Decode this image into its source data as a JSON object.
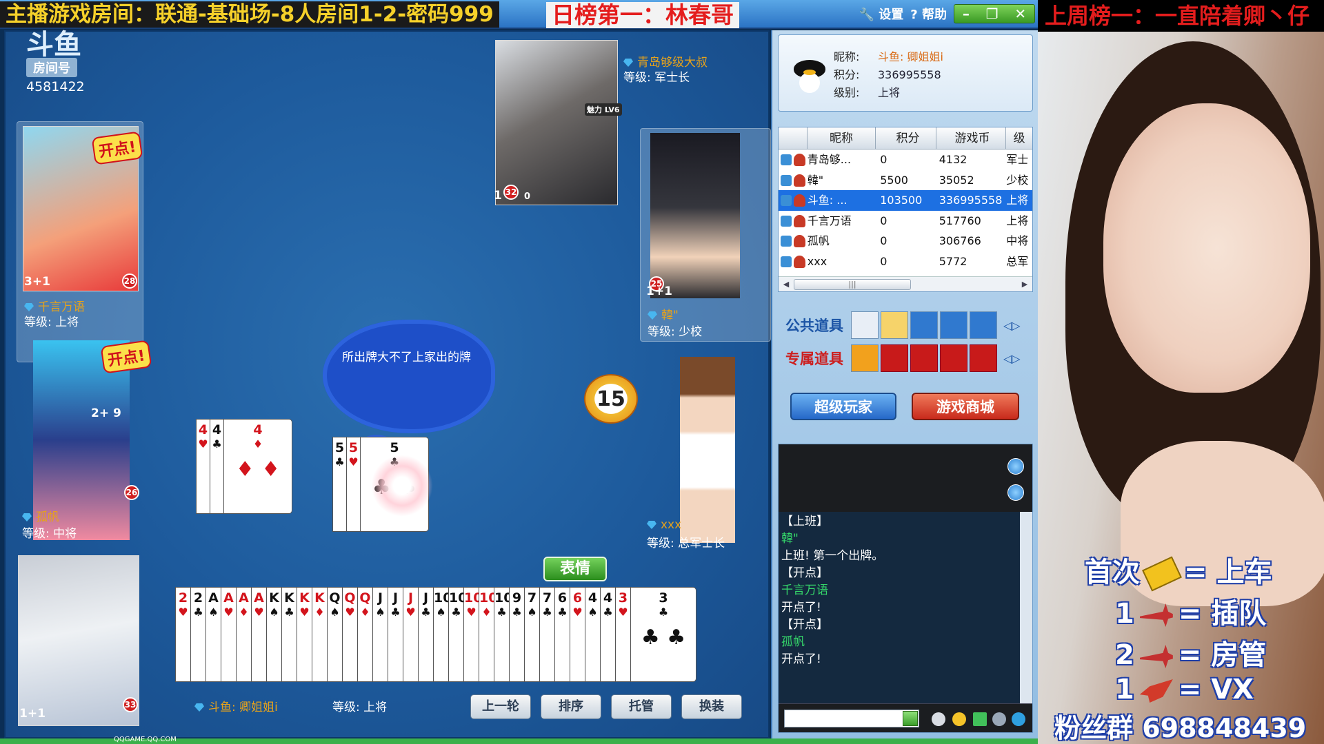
{
  "banners": {
    "room": "主播游戏房间：联通-基础场-8人房间1-2-密码999",
    "day": "日榜第一：林春哥",
    "week": "上周榜一：一直陪着卿丶仔"
  },
  "window": {
    "settings": "设置",
    "help": "帮助",
    "minimize": "–",
    "restore": "❐",
    "close": "✕"
  },
  "room": {
    "logo": "斗鱼",
    "label": "房间号",
    "number": "4581422"
  },
  "players": [
    {
      "name": "千言万语",
      "level": "等级: 上将",
      "badge": "28",
      "count": "3",
      "plus": "+1",
      "kaidian": "开点!"
    },
    {
      "name": "孤帆",
      "level": "等级: 中将",
      "badge": "26",
      "count": "2",
      "plus": "+ 9",
      "kaidian": "开点!"
    },
    {
      "name": "斗鱼: 卿姐姐i",
      "level": "等级: 上将",
      "badge": "33",
      "count": "1",
      "plus": "+1"
    },
    {
      "name": "青岛够级大叔",
      "level": "等级: 军士长",
      "badge": "32",
      "count": "1",
      "plus": "0",
      "tag": "魅力 LV6"
    },
    {
      "name": "韓\"",
      "level": "等级: 少校",
      "badge": "25",
      "count": "1",
      "plus": "+1"
    },
    {
      "name": "xxx",
      "level": "等级: 总军士长"
    }
  ],
  "table": {
    "cloud_msg": "所出牌大不了上家出的牌",
    "timer": "15",
    "emote_btn": "表情",
    "played_left": [
      {
        "rank": "4",
        "suit": "♥",
        "color": "red"
      },
      {
        "rank": "4",
        "suit": "♣",
        "color": "blk"
      },
      {
        "rank": "4",
        "suit": "♦",
        "color": "red"
      }
    ],
    "played_center": [
      {
        "rank": "5",
        "suit": "♣",
        "color": "blk"
      },
      {
        "rank": "5",
        "suit": "♥",
        "color": "red"
      },
      {
        "rank": "5",
        "suit": "♣",
        "color": "blk"
      }
    ],
    "hand": [
      {
        "rank": "2",
        "suit": "♥",
        "color": "red"
      },
      {
        "rank": "2",
        "suit": "♣",
        "color": "blk"
      },
      {
        "rank": "A",
        "suit": "♠",
        "color": "blk"
      },
      {
        "rank": "A",
        "suit": "♥",
        "color": "red"
      },
      {
        "rank": "A",
        "suit": "♦",
        "color": "red"
      },
      {
        "rank": "A",
        "suit": "♥",
        "color": "red"
      },
      {
        "rank": "K",
        "suit": "♠",
        "color": "blk"
      },
      {
        "rank": "K",
        "suit": "♣",
        "color": "blk"
      },
      {
        "rank": "K",
        "suit": "♥",
        "color": "red"
      },
      {
        "rank": "K",
        "suit": "♦",
        "color": "red"
      },
      {
        "rank": "Q",
        "suit": "♠",
        "color": "blk"
      },
      {
        "rank": "Q",
        "suit": "♥",
        "color": "red"
      },
      {
        "rank": "Q",
        "suit": "♦",
        "color": "red"
      },
      {
        "rank": "J",
        "suit": "♠",
        "color": "blk"
      },
      {
        "rank": "J",
        "suit": "♣",
        "color": "blk"
      },
      {
        "rank": "J",
        "suit": "♥",
        "color": "red"
      },
      {
        "rank": "J",
        "suit": "♣",
        "color": "blk"
      },
      {
        "rank": "10",
        "suit": "♠",
        "color": "blk"
      },
      {
        "rank": "10",
        "suit": "♣",
        "color": "blk"
      },
      {
        "rank": "10",
        "suit": "♥",
        "color": "red"
      },
      {
        "rank": "10",
        "suit": "♦",
        "color": "red"
      },
      {
        "rank": "10",
        "suit": "♣",
        "color": "blk"
      },
      {
        "rank": "9",
        "suit": "♣",
        "color": "blk"
      },
      {
        "rank": "7",
        "suit": "♠",
        "color": "blk"
      },
      {
        "rank": "7",
        "suit": "♣",
        "color": "blk"
      },
      {
        "rank": "6",
        "suit": "♣",
        "color": "blk"
      },
      {
        "rank": "6",
        "suit": "♥",
        "color": "red"
      },
      {
        "rank": "4",
        "suit": "♠",
        "color": "blk"
      },
      {
        "rank": "4",
        "suit": "♣",
        "color": "blk"
      },
      {
        "rank": "3",
        "suit": "♥",
        "color": "red"
      },
      {
        "rank": "3",
        "suit": "♣",
        "color": "blk"
      }
    ],
    "buttons": [
      "上一轮",
      "排序",
      "托管",
      "换装"
    ]
  },
  "profile": {
    "nick_k": "昵称:",
    "nick_v": "斗鱼: 卿姐姐i",
    "score_k": "积分:",
    "score_v": "336995558",
    "rank_k": "级别:",
    "rank_v": "上将"
  },
  "leaderboard": {
    "headers": [
      "",
      "昵称",
      "积分",
      "游戏币",
      "级"
    ],
    "rows": [
      {
        "name": "青岛够...",
        "score": "0",
        "coins": "4132",
        "rank": "军士"
      },
      {
        "name": "韓\"",
        "score": "5500",
        "coins": "35052",
        "rank": "少校"
      },
      {
        "name": "斗鱼: ...",
        "score": "103500",
        "coins": "336995558",
        "rank": "上将"
      },
      {
        "name": "千言万语",
        "score": "0",
        "coins": "517760",
        "rank": "上将"
      },
      {
        "name": "孤帆",
        "score": "0",
        "coins": "306766",
        "rank": "中将"
      },
      {
        "name": "xxx",
        "score": "0",
        "coins": "5772",
        "rank": "总军"
      }
    ],
    "selected": 2
  },
  "props": {
    "public": "公共道具",
    "exclusive": "专属道具"
  },
  "actions": {
    "super": "超级玩家",
    "shop": "游戏商城"
  },
  "chat": [
    {
      "text": "【上班】",
      "type": "sys"
    },
    {
      "text": "韓\"",
      "type": "name"
    },
    {
      "text": "上班! 第一个出牌。",
      "type": "msg"
    },
    {
      "text": "【开点】",
      "type": "sys"
    },
    {
      "text": "千言万语",
      "type": "name"
    },
    {
      "text": "开点了!",
      "type": "msg"
    },
    {
      "text": "【开点】",
      "type": "sys"
    },
    {
      "text": "孤帆",
      "type": "name"
    },
    {
      "text": "开点了!",
      "type": "msg"
    }
  ],
  "promo": [
    {
      "left": "首次",
      "right": "= 上车",
      "icon": "ticket"
    },
    {
      "left": "1",
      "right": "= 插队",
      "icon": "plane"
    },
    {
      "left": "2",
      "right": "= 房管",
      "icon": "plane"
    },
    {
      "left": "1",
      "right": "= VX",
      "icon": "rocket"
    }
  ],
  "fans": "粉丝群 698848439",
  "footer": "QQGAME.QQ.COM"
}
